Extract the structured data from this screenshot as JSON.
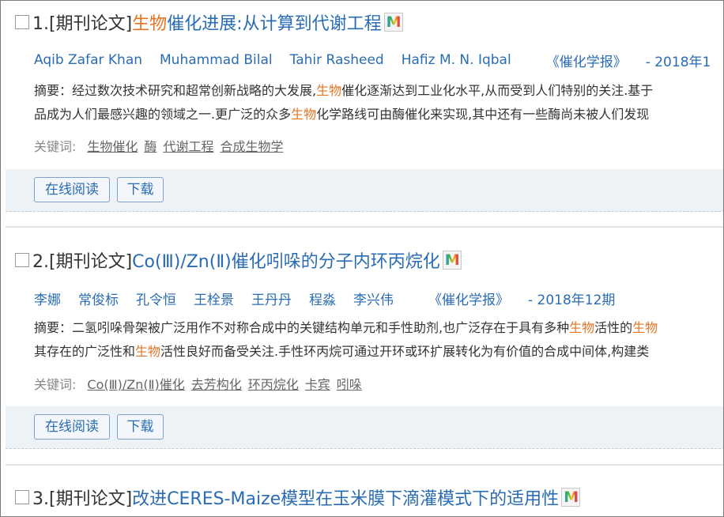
{
  "results": [
    {
      "index": "1.",
      "type": "[期刊论文]",
      "title_hl": "生物",
      "title_rest": "催化进展:从计算到代谢工程",
      "title_pre": "",
      "authors": [
        "Aqib Zafar Khan",
        "Muhammad Bilal",
        "Tahir Rasheed",
        "Hafiz M. N. Iqbal"
      ],
      "journal": "《催化学报》",
      "issue": "- 2018年1",
      "abstract_label": "摘要：",
      "abstract_line1_a": "经过数次技术研究和超常创新战略的大发展,",
      "abstract_line1_hl": "生物",
      "abstract_line1_b": "催化逐渐达到工业化水平,从而受到人们特别的关注.基于",
      "abstract_line2_a": "品成为人们最感兴趣的领域之一.更广泛的众多",
      "abstract_line2_hl": "生物",
      "abstract_line2_b": "化学路线可由酶催化来实现,其中还有一些酶尚未被人们发现",
      "keywords_label": "关键词:",
      "keywords": [
        "生物催化",
        "酶",
        "代谢工程",
        "合成生物学"
      ],
      "read_label": "在线阅读",
      "download_label": "下载"
    },
    {
      "index": "2.",
      "type": "[期刊论文]",
      "title_hl": "",
      "title_rest": "Co(Ⅲ)/Zn(Ⅱ)催化吲哚的分子内环丙烷化",
      "authors": [
        "李娜",
        "常俊标",
        "孔令恒",
        "王栓景",
        "王丹丹",
        "程淼",
        "李兴伟"
      ],
      "journal": "《催化学报》",
      "issue": "- 2018年12期",
      "abstract_label": "摘要：",
      "abstract_line1_a": "二氢吲哚骨架被广泛用作不对称合成中的关键结构单元和手性助剂,也广泛存在于具有多种",
      "abstract_line1_hl": "生物",
      "abstract_line1_b": "活性的",
      "abstract_line1_c": "生物",
      "abstract_line2_a": "其存在的广泛性和",
      "abstract_line2_hl": "生物",
      "abstract_line2_b": "活性良好而备受关注.手性环丙烷可通过开环或环扩展转化为有价值的合成中间体,构建类",
      "keywords_label": "关键词:",
      "keywords": [
        "Co(Ⅲ)/Zn(Ⅱ)催化",
        "去芳构化",
        "环丙烷化",
        "卡宾",
        "吲哚"
      ],
      "read_label": "在线阅读",
      "download_label": "下载"
    },
    {
      "index": "3.",
      "type": "[期刊论文]",
      "title_hl": "",
      "title_rest": "改进CERES-Maize模型在玉米膜下滴灌模式下的适用性"
    }
  ],
  "m_icon_letter": "M",
  "colors": {
    "link": "#2a6cb3",
    "highlight": "#e57422",
    "action_bar": "#edf2f7"
  }
}
